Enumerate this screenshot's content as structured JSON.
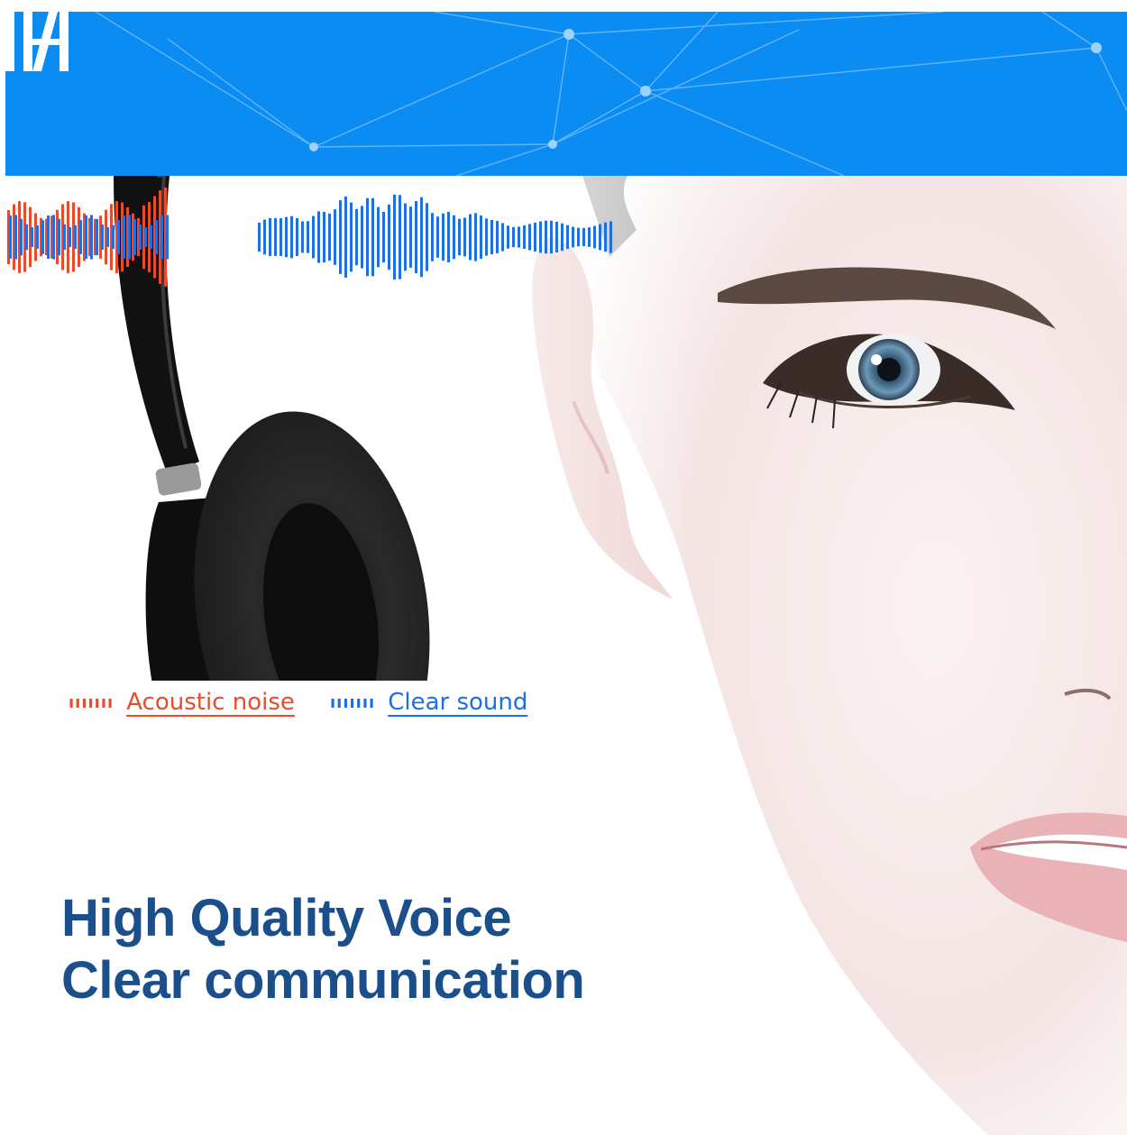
{
  "colors": {
    "banner": "#0a8cf3",
    "noise": "#e84c2c",
    "clear": "#1f6fe0",
    "headline": "#1a4f8b"
  },
  "legend": {
    "noise": {
      "glyph": "ııııııı",
      "label": "Acoustic noise"
    },
    "clear": {
      "glyph": "ııııııı",
      "label": "Clear sound"
    }
  },
  "headline": {
    "line1": "High Quality Voice",
    "line2": "Clear communication"
  }
}
